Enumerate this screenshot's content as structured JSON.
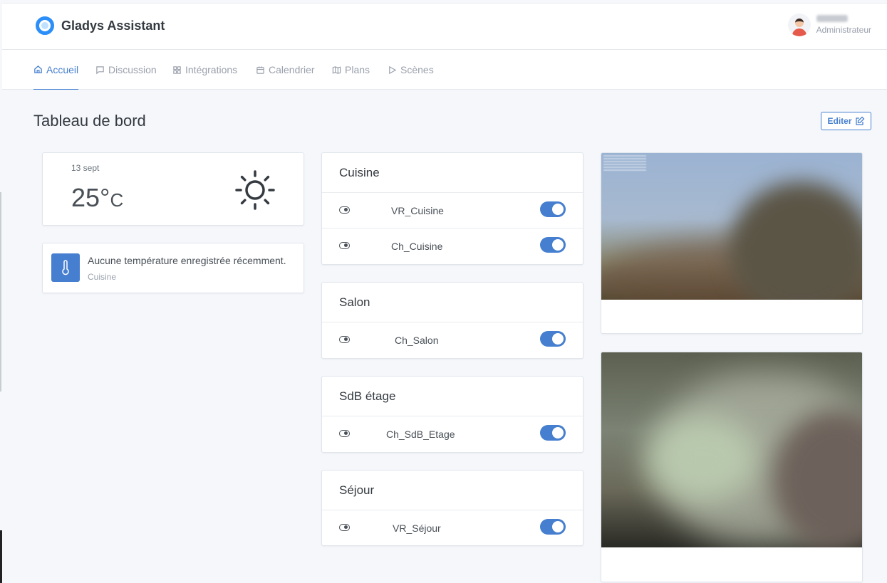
{
  "header": {
    "brand": "Gladys Assistant",
    "user_role": "Administrateur"
  },
  "nav": {
    "items": [
      {
        "label": "Accueil",
        "icon": "home-icon",
        "active": true
      },
      {
        "label": "Discussion",
        "icon": "message-icon",
        "active": false
      },
      {
        "label": "Intégrations",
        "icon": "grid-icon",
        "active": false
      },
      {
        "label": "Calendrier",
        "icon": "calendar-icon",
        "active": false
      },
      {
        "label": "Plans",
        "icon": "map-icon",
        "active": false
      },
      {
        "label": "Scènes",
        "icon": "play-icon",
        "active": false
      }
    ]
  },
  "main": {
    "title": "Tableau de bord",
    "edit_label": "Editer"
  },
  "weather": {
    "date": "13 sept",
    "temperature": "25°",
    "unit": "C",
    "icon": "sun-icon"
  },
  "temperature_card": {
    "message": "Aucune température enregistrée récemment.",
    "room": "Cuisine",
    "icon": "thermometer-icon"
  },
  "rooms": [
    {
      "name": "Cuisine",
      "devices": [
        {
          "name": "VR_Cuisine",
          "on": true
        },
        {
          "name": "Ch_Cuisine",
          "on": true
        }
      ]
    },
    {
      "name": "Salon",
      "devices": [
        {
          "name": "Ch_Salon",
          "on": true
        }
      ]
    },
    {
      "name": "SdB étage",
      "devices": [
        {
          "name": "Ch_SdB_Etage",
          "on": true
        }
      ]
    },
    {
      "name": "Séjour",
      "devices": [
        {
          "name": "VR_Séjour",
          "on": true
        }
      ]
    }
  ],
  "colors": {
    "accent": "#467fcf",
    "background": "#f5f7fb"
  }
}
